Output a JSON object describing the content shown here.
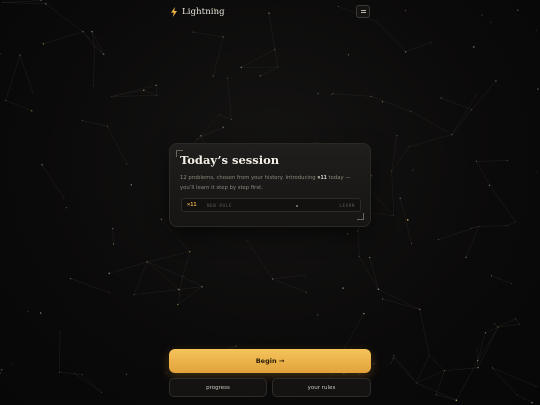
{
  "header": {
    "brand": "Lightning",
    "logo_icon": "lightning-bolt-icon",
    "menu_icon": "menu-icon"
  },
  "session_card": {
    "title": "Today’s session",
    "desc_prefix": "12 problems, chosen from your history. Introducing ",
    "desc_op": "×11",
    "desc_suffix": " today — you’ll learn it step by step first.",
    "new_op": {
      "operator": "×11",
      "tag": "NEW RULE",
      "action": "LEARN"
    }
  },
  "actions": {
    "begin": "Begin →",
    "progress": "progress",
    "rules": "your rules"
  },
  "colors": {
    "accent": "#e6a93d",
    "background": "#0b0a0a",
    "card": "#1a1918"
  }
}
